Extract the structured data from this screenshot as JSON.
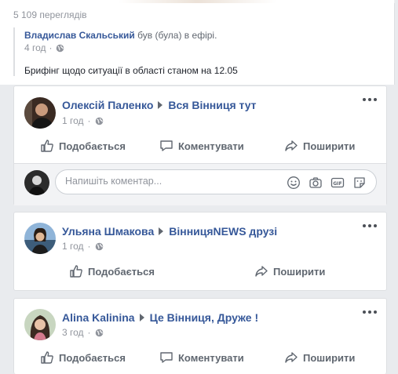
{
  "shared_post": {
    "views": "5 109 переглядів",
    "author": "Владислав Скальський",
    "verb": "був (була) в ефірі.",
    "time": "4 год",
    "text": "Брифінг щодо ситуації в області станом на 12.05"
  },
  "cards": [
    {
      "author": "Олексій Паленко",
      "group": "Вся Вінниця тут",
      "time": "1 год",
      "actions": {
        "like": "Подобається",
        "comment": "Коментувати",
        "share": "Поширити"
      },
      "comment_placeholder": "Напишіть коментар..."
    },
    {
      "author": "Ульяна Шмакова",
      "group": "ВінницяNEWS друзі",
      "time": "1 год",
      "actions": {
        "like": "Подобається",
        "share": "Поширити"
      }
    },
    {
      "author": "Alina Kalinina",
      "group": "Це Вінниця, Друже !",
      "time": "3 год",
      "actions": {
        "like": "Подобається",
        "comment": "Коментувати",
        "share": "Поширити"
      }
    }
  ],
  "icons": {
    "globe": "globe-icon",
    "more": "more-options-icon",
    "like": "thumbs-up-icon",
    "comment": "comment-bubble-icon",
    "share": "share-arrow-icon",
    "emoji": "emoji-icon",
    "camera": "camera-icon",
    "gif": "gif-icon",
    "sticker": "sticker-icon"
  },
  "colors": {
    "link": "#365899",
    "muted": "#90949c",
    "action": "#606770",
    "background": "#e9ebee"
  }
}
